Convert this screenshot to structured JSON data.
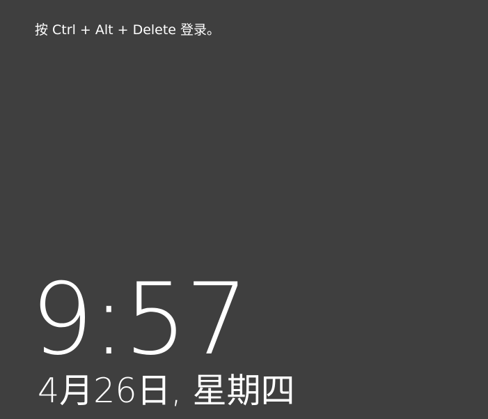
{
  "lock_screen": {
    "signin_hint": "按 Ctrl + Alt + Delete 登录。",
    "time": "9:57",
    "date": "4月26日, 星期四"
  },
  "colors": {
    "background": "#3f3f3f",
    "text": "#ffffff"
  }
}
